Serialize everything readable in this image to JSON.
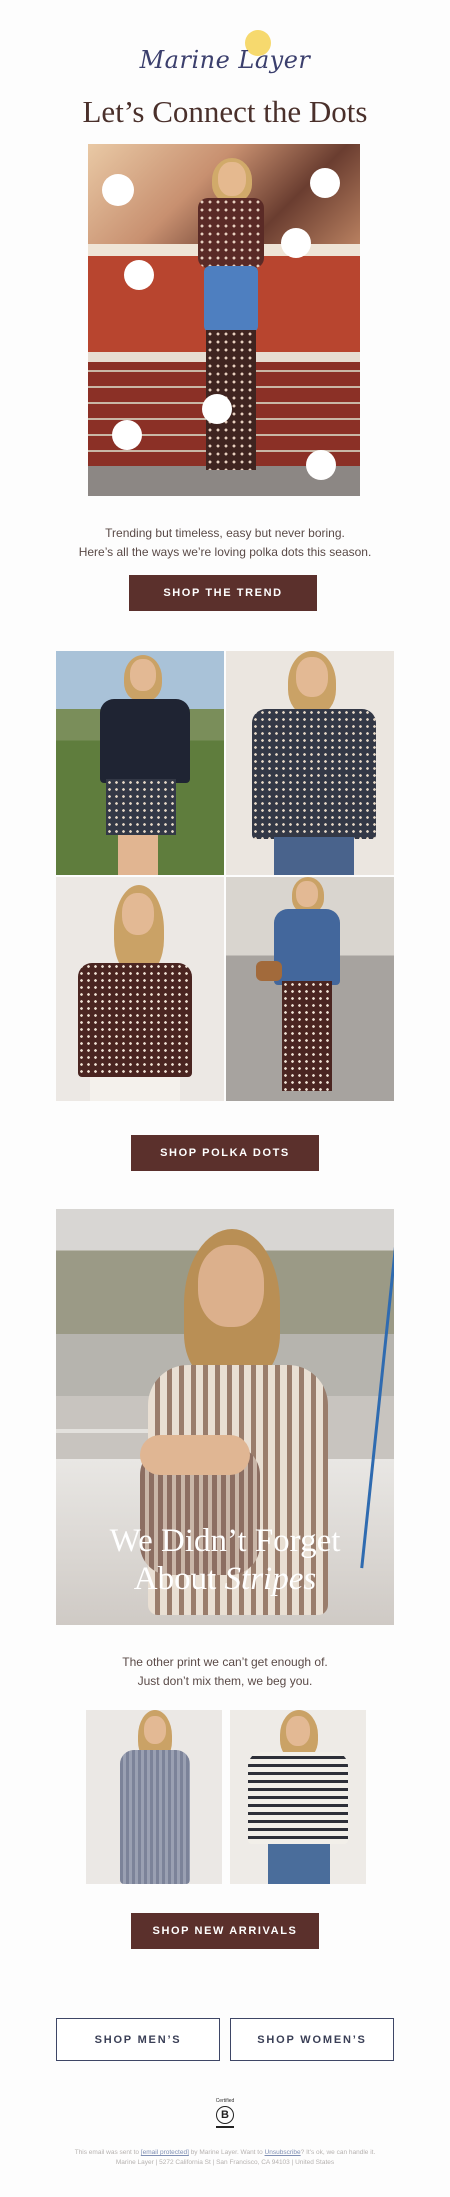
{
  "brand": {
    "logo_text": "Marine Layer"
  },
  "headline": "Let’s Connect the Dots",
  "intro": {
    "line1": "Trending but timeless, easy but never boring.",
    "line2": "Here’s all the ways we’re loving polka dots this season."
  },
  "buttons": {
    "shop_trend": "SHOP THE TREND",
    "shop_polka": "SHOP POLKA DOTS",
    "shop_new": "SHOP NEW ARRIVALS",
    "shop_mens": "SHOP MEN’S",
    "shop_womens": "SHOP WOMEN’S"
  },
  "stripes": {
    "title_line1": "We Didn’t Forget",
    "title_line2_prefix": "About ",
    "title_line2_em": "Stripes",
    "copy_line1": "The other print we can’t get enough of.",
    "copy_line2": "Just don’t mix them, we beg you."
  },
  "bcorp": {
    "certified": "Certified",
    "letter": "B"
  },
  "footer": {
    "part1": "This email was sent to ",
    "email_link": "[email protected]",
    "part2": " by Marine Layer. Want to ",
    "unsubscribe": "Unsubscribe",
    "part3": "? It's ok, we can handle it.",
    "address": "Marine Layer | 5272 California St | San Francisco, CA 94103 | United States"
  },
  "colors": {
    "accent": "#5b302c",
    "headline": "#4a302b",
    "outline": "#3e4666",
    "logo": "#3b3f6d",
    "logo_sun": "#f6d96e"
  }
}
